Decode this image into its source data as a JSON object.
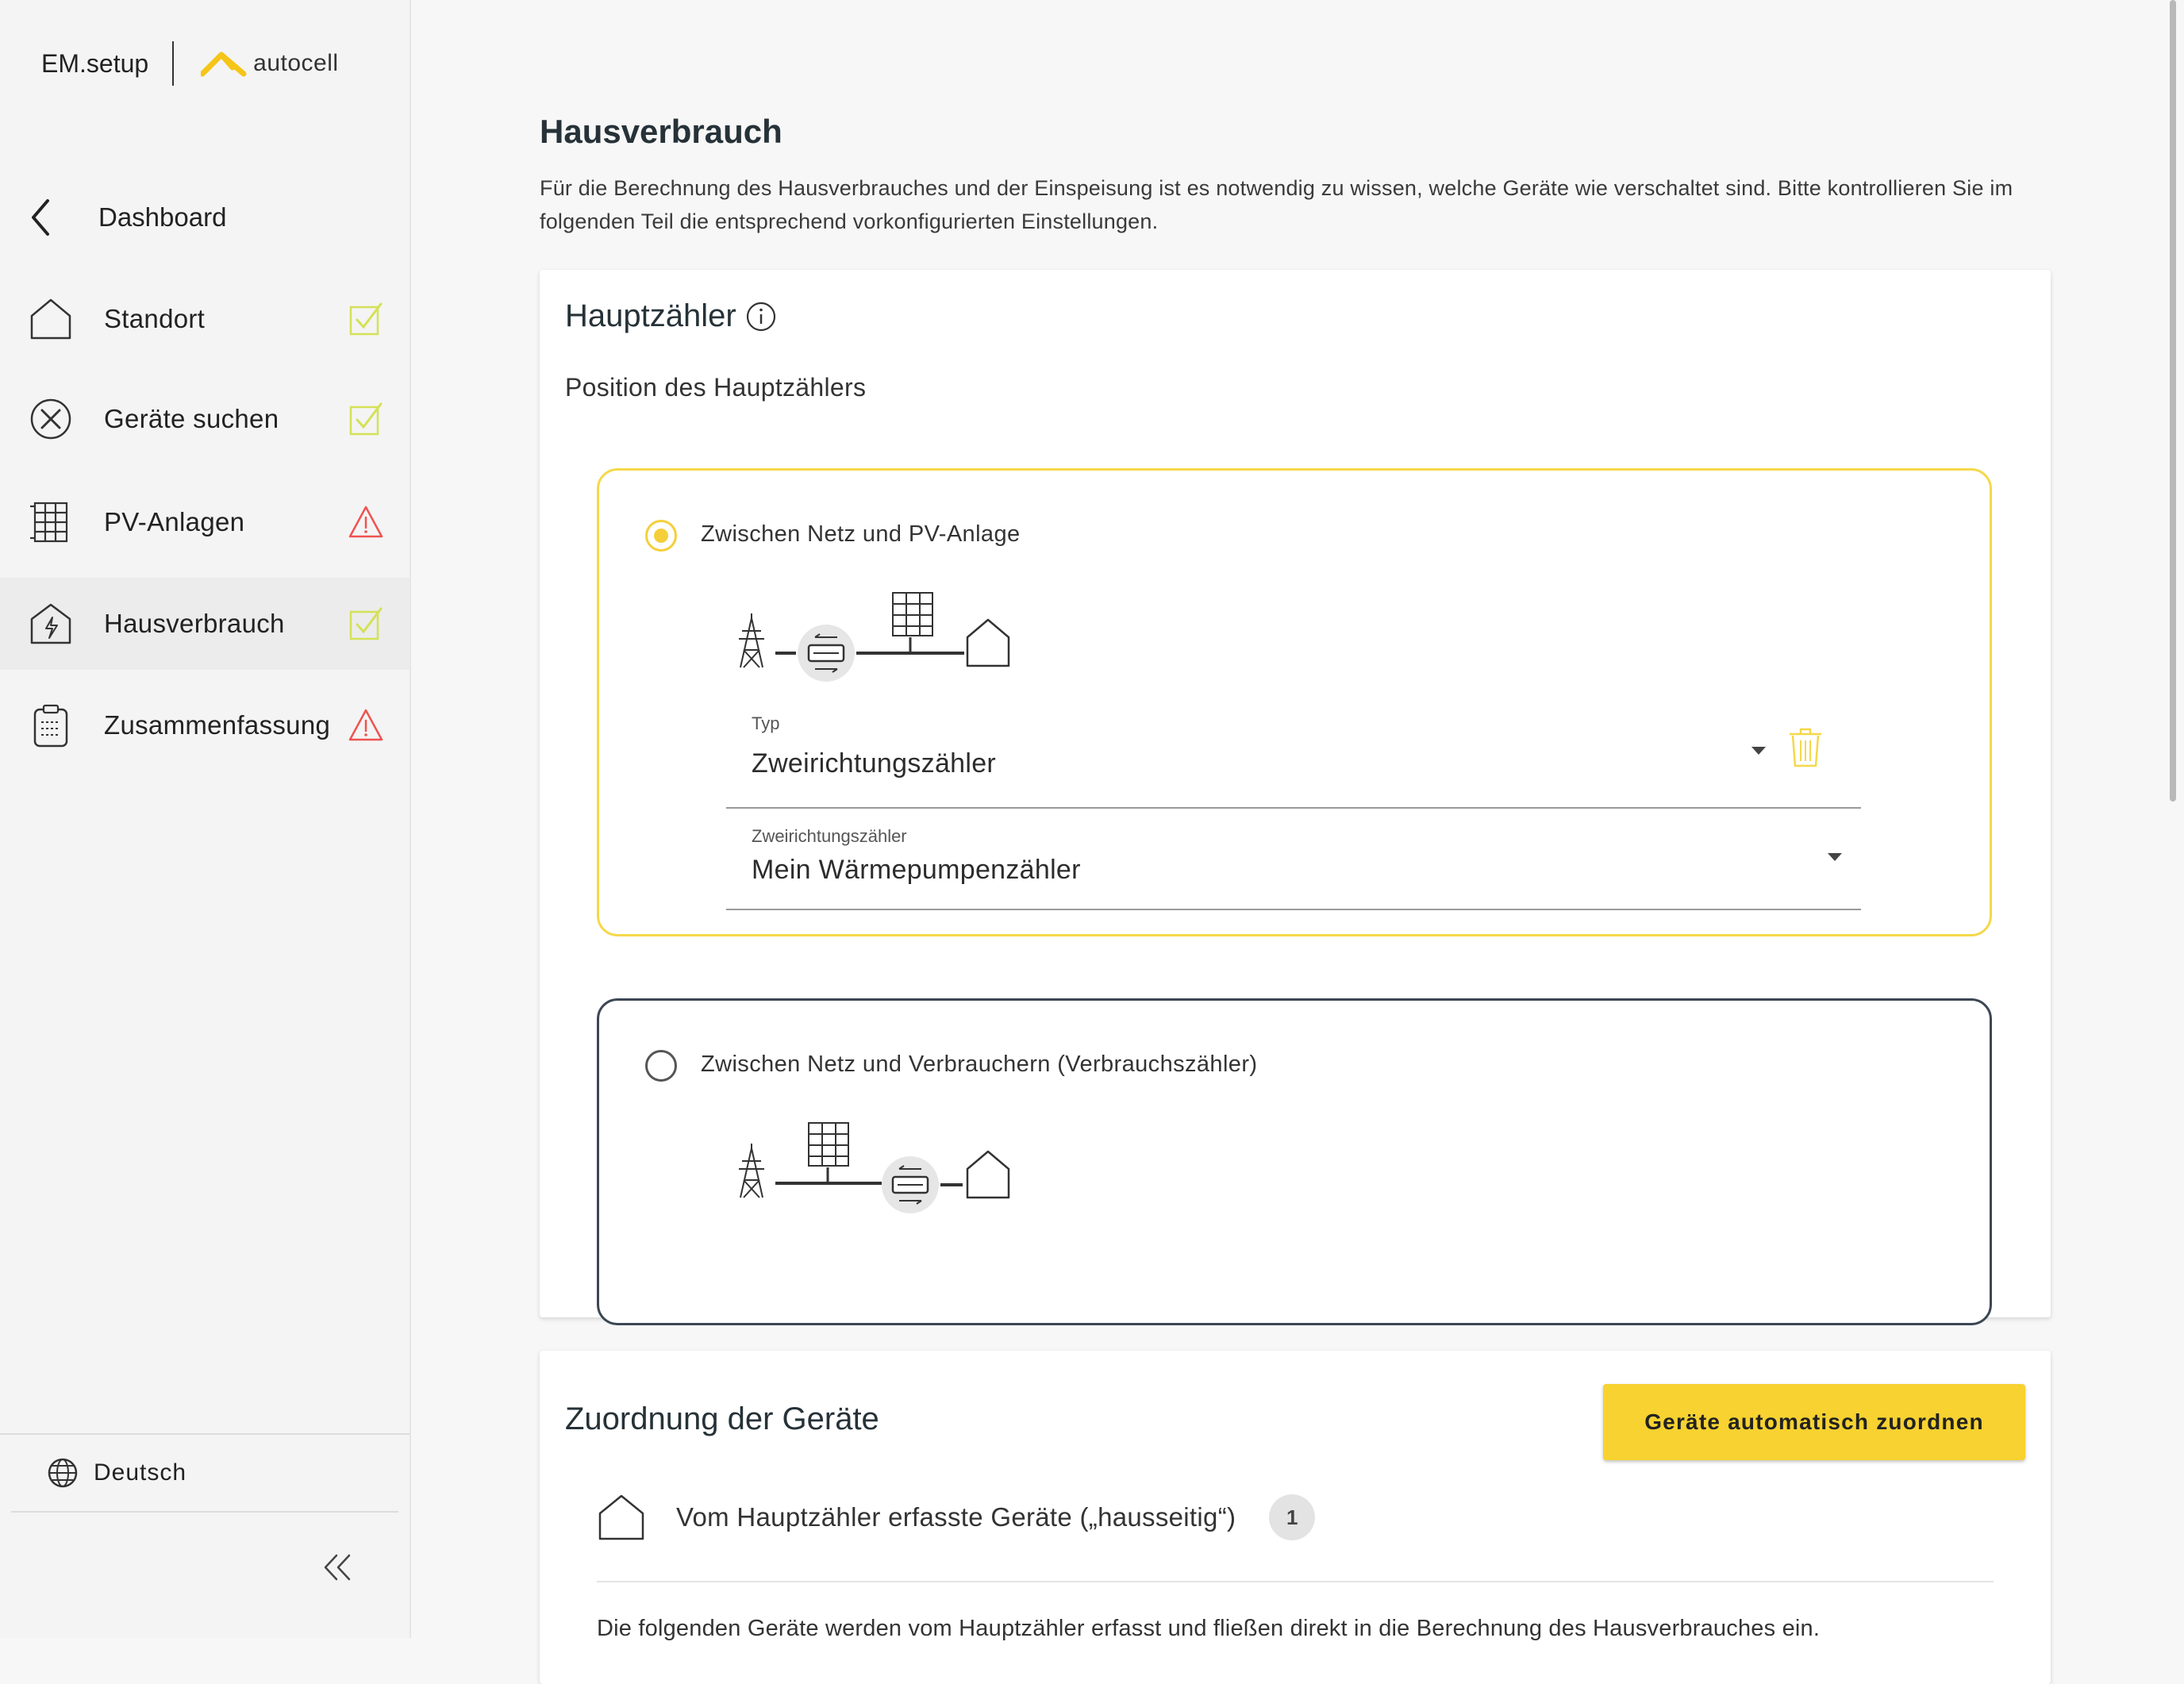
{
  "brand": {
    "app_name": "EM.setup",
    "company": "autocell"
  },
  "sidebar": {
    "back_label": "Dashboard",
    "items": [
      {
        "label": "Standort",
        "icon": "house-icon",
        "status": "check-icon",
        "status_color": "#d4e157"
      },
      {
        "label": "Geräte suchen",
        "icon": "tools-icon",
        "status": "check-icon",
        "status_color": "#d4e157"
      },
      {
        "label": "PV-Anlagen",
        "icon": "solar-panel-icon",
        "status": "warning-icon",
        "status_color": "#ef5350"
      },
      {
        "label": "Hausverbrauch",
        "icon": "house-energy-icon",
        "status": "check-icon",
        "status_color": "#d4e157",
        "active": true
      },
      {
        "label": "Zusammenfassung",
        "icon": "clipboard-icon",
        "status": "warning-icon",
        "status_color": "#ef5350"
      }
    ],
    "language": "Deutsch"
  },
  "main": {
    "title": "Hausverbrauch",
    "description": "Für die Berechnung des Hausverbrauches und der Einspeisung ist es notwendig zu wissen, welche Geräte wie verschaltet sind. Bitte kontrollieren Sie im folgenden Teil die entsprechend vorkonfigurierten Einstellungen.",
    "main_meter": {
      "title": "Hauptzähler",
      "position_label": "Position des Hauptzählers",
      "options": [
        {
          "label": "Zwischen Netz und PV-Anlage",
          "selected": true,
          "type_label": "Typ",
          "type_value": "Zweirichtungszähler",
          "meter_label": "Zweirichtungszähler",
          "meter_value": "Mein Wärmepumpenzähler"
        },
        {
          "label": "Zwischen Netz und Verbrauchern (Verbrauchszähler)",
          "selected": false
        }
      ]
    },
    "assignment": {
      "title": "Zuordnung der Geräte",
      "auto_button": "Geräte automatisch zuordnen",
      "house_side_label": "Vom Hauptzähler erfasste Geräte („hausseitig“)",
      "house_side_count": "1",
      "note": "Die folgenden Geräte werden vom Hauptzähler erfasst und fließen direkt in die Berechnung des Hausverbrauches ein."
    }
  },
  "colors": {
    "accent": "#f7d230",
    "selected_border": "#f5d84a",
    "unselected_border": "#3c4654",
    "heading": "#263238"
  }
}
